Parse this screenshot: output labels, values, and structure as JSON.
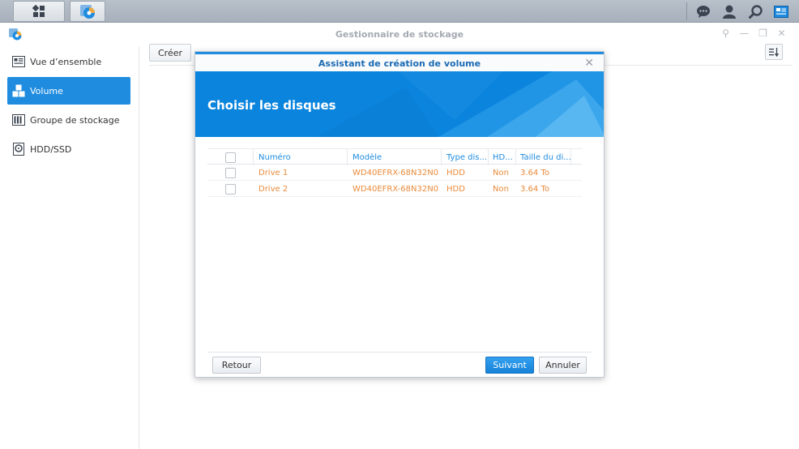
{
  "window": {
    "title": "Gestionnaire de stockage"
  },
  "sidebar": {
    "items": [
      {
        "label": "Vue d’ensemble",
        "icon": "overview-icon"
      },
      {
        "label": "Volume",
        "icon": "volume-icon",
        "active": true
      },
      {
        "label": "Groupe de stockage",
        "icon": "storage-pool-icon"
      },
      {
        "label": "HDD/SSD",
        "icon": "hdd-icon"
      }
    ]
  },
  "toolbar": {
    "create_label": "Créer"
  },
  "dialog": {
    "title": "Assistant de création de volume",
    "heading": "Choisir les disques",
    "columns": [
      "Numéro",
      "Modèle",
      "Type dis...",
      "HD...",
      "Taille du di..."
    ],
    "rows": [
      {
        "number": "Drive 1",
        "model": "WD40EFRX-68N32N0",
        "type": "HDD",
        "hd": "Non",
        "size": "3.64 To"
      },
      {
        "number": "Drive 2",
        "model": "WD40EFRX-68N32N0",
        "type": "HDD",
        "hd": "Non",
        "size": "3.64 To"
      }
    ],
    "back_label": "Retour",
    "next_label": "Suivant",
    "cancel_label": "Annuler"
  },
  "colors": {
    "accent": "#1f8ce0",
    "value_text": "#e88a3a"
  }
}
